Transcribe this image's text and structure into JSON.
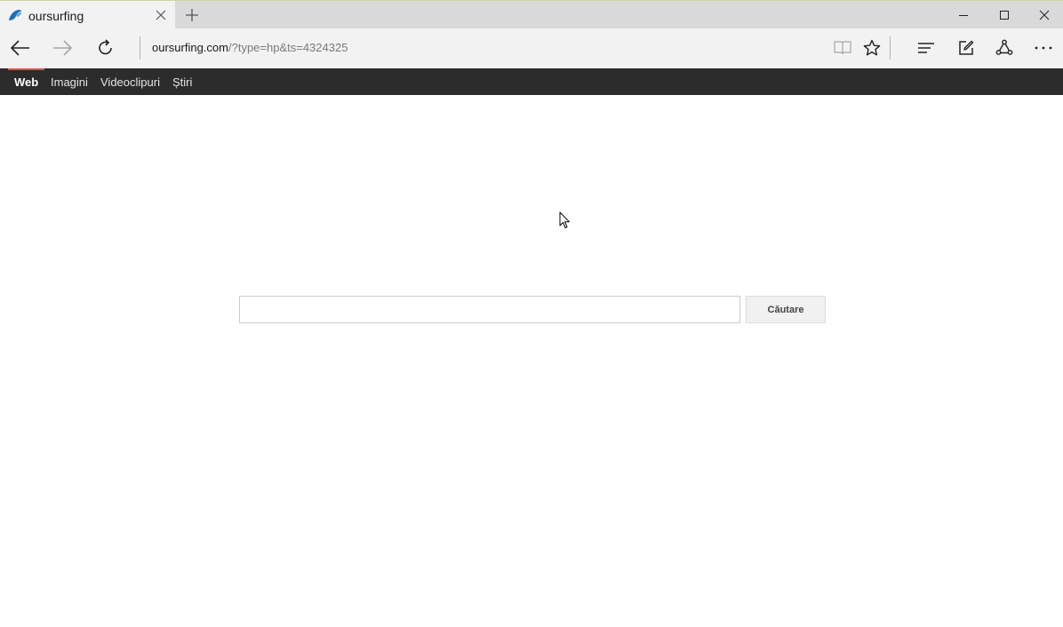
{
  "browser": {
    "tab": {
      "title": "oursurfing",
      "favicon": "wave-favicon-icon"
    },
    "address_bar": {
      "host": "oursurfing.com",
      "path": "/?type=hp&ts=4324325"
    },
    "icons": {
      "back": "back-arrow-icon",
      "forward": "forward-arrow-icon",
      "refresh": "refresh-icon",
      "reading_view": "reading-view-icon",
      "favorite": "star-icon",
      "hub": "hub-icon",
      "web_note": "web-note-icon",
      "share": "share-icon",
      "more": "more-icon"
    }
  },
  "verticals": {
    "items": [
      {
        "label": "Web",
        "active": true
      },
      {
        "label": "Imagini",
        "active": false
      },
      {
        "label": "Videoclipuri",
        "active": false
      },
      {
        "label": "Știri",
        "active": false
      }
    ],
    "accent_color": "#d9534f",
    "bar_color": "#2c2c2c"
  },
  "search": {
    "value": "",
    "button_label": "Căutare"
  }
}
